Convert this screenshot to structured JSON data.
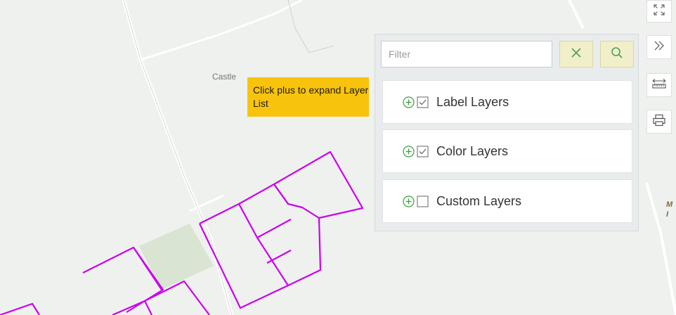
{
  "map": {
    "place_label": "Castle",
    "edge_label": "M\nI",
    "colors": {
      "background": "#eef1ee",
      "roads": "#ffffff",
      "parcel_lines": "#cc00ee",
      "green_area": "#d9e4d2"
    }
  },
  "tooltip": {
    "text": "Click plus to expand Layer List",
    "background": "#f8c30c"
  },
  "layer_panel": {
    "filter": {
      "value": "",
      "placeholder": "Filter"
    },
    "clear_icon": "close-x-icon",
    "search_icon": "search-icon",
    "layers": [
      {
        "label": "Label Layers",
        "checked": true,
        "expand_icon": "plus-circle-icon"
      },
      {
        "label": "Color Layers",
        "checked": true,
        "expand_icon": "plus-circle-icon"
      },
      {
        "label": "Custom Layers",
        "checked": false,
        "expand_icon": "plus-circle-icon"
      }
    ]
  },
  "toolbar": {
    "tools": [
      {
        "name": "fullscreen",
        "icon": "fullscreen-icon"
      },
      {
        "name": "collapse",
        "icon": "double-chevron-right-icon"
      },
      {
        "name": "measure",
        "icon": "ruler-icon"
      },
      {
        "name": "print",
        "icon": "printer-icon"
      }
    ]
  }
}
